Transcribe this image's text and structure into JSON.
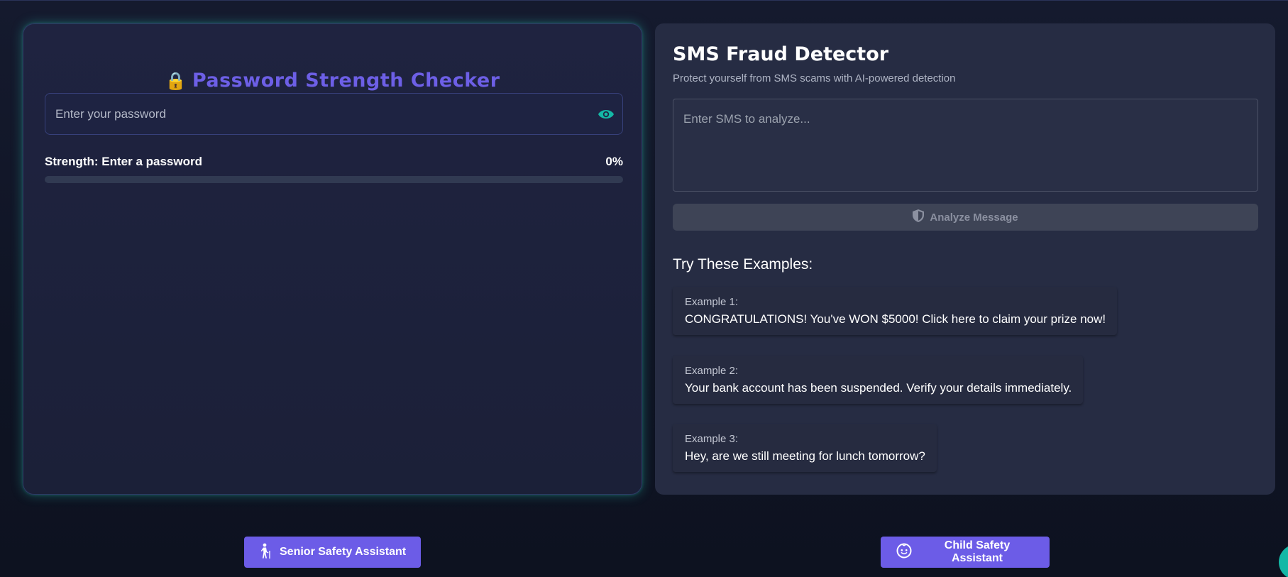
{
  "password_checker": {
    "title": "Password Strength Checker",
    "input_placeholder": "Enter your password",
    "strength_label": "Strength: Enter a password",
    "strength_percent": "0%",
    "strength_value": 0,
    "icons": {
      "title_icon": "lock-icon",
      "toggle_icon": "eye-icon"
    }
  },
  "sms_detector": {
    "title": "SMS Fraud Detector",
    "subtitle": "Protect yourself from SMS scams with AI-powered detection",
    "input_placeholder": "Enter SMS to analyze...",
    "analyze_label": "Analyze Message",
    "analyze_icon": "shield-icon",
    "examples_heading": "Try These Examples:",
    "examples": [
      {
        "label": "Example 1:",
        "text": "CONGRATULATIONS! You've WON $5000! Click here to claim your prize now!"
      },
      {
        "label": "Example 2:",
        "text": "Your bank account has been suspended. Verify your details immediately."
      },
      {
        "label": "Example 3:",
        "text": "Hey, are we still meeting for lunch tomorrow?"
      }
    ]
  },
  "footer_buttons": {
    "senior_label": "Senior Safety Assistant",
    "senior_icon": "elderly-person-icon",
    "child_label": "Child Safety Assistant",
    "child_icon": "child-face-icon"
  },
  "colors": {
    "accent": "#6c5ce7",
    "teal": "#14b8a6",
    "card_bg": "#262c43",
    "page_bg": "#111827"
  }
}
